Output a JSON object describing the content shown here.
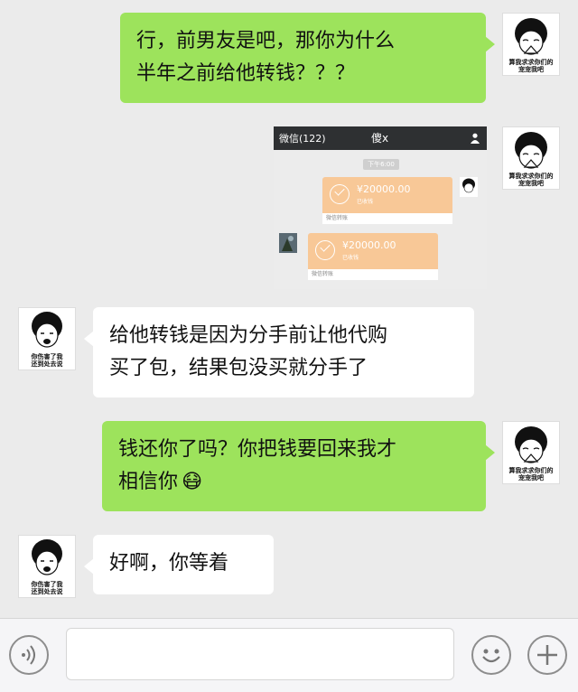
{
  "messages": [
    {
      "side": "right",
      "lines": [
        "行，前男友是吧，那你为什么",
        "半年之前给他转钱？？？"
      ]
    },
    {
      "side": "left",
      "lines": [
        "给他转钱是因为分手前让他代购",
        "买了包，结果包没买就分手了"
      ]
    },
    {
      "side": "right",
      "lines": [
        "钱还你了吗？你把钱要回来我才",
        "相信你"
      ],
      "emoji": "😷"
    },
    {
      "side": "left",
      "lines": [
        "好啊，你等着"
      ]
    }
  ],
  "avatars": {
    "right_caption": "算我求求你们的\n宠宠我吧",
    "left_caption": "你伤害了我\n还到处去说"
  },
  "screenshot": {
    "back_label": "微信(122)",
    "title": "傻x",
    "time": "下午6:00",
    "transfers": [
      {
        "amount": "¥20000.00",
        "status": "已收钱",
        "footer": "微信转账"
      },
      {
        "amount": "¥20000.00",
        "status": "已收钱",
        "footer": "微信转账"
      }
    ]
  },
  "input_bar": {
    "text": ""
  }
}
